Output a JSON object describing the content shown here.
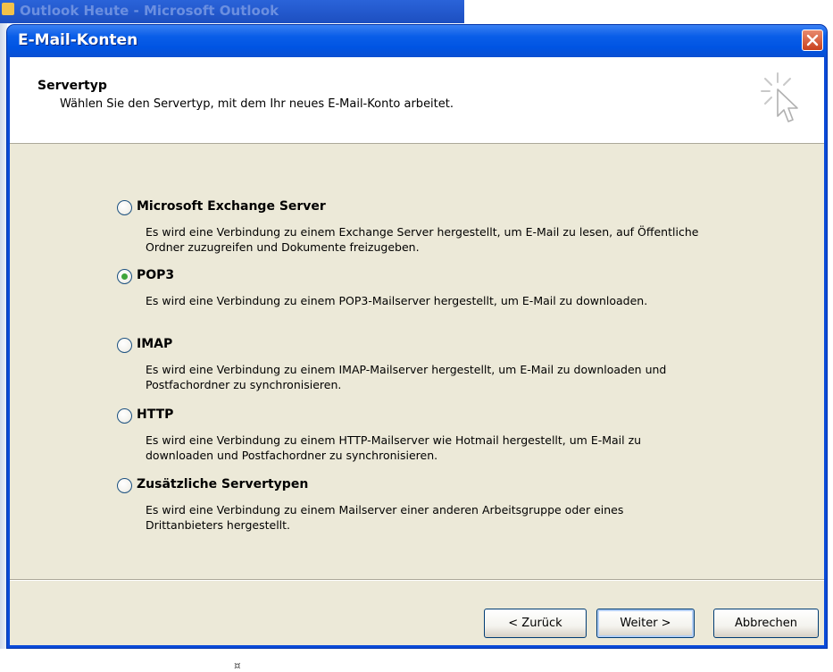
{
  "background_window": {
    "title": "Outlook Heute - Microsoft Outlook",
    "mark": "¤"
  },
  "dialog": {
    "title": "E-Mail-Konten",
    "close_icon": "close-icon"
  },
  "header": {
    "title": "Servertyp",
    "subtitle": "Wählen Sie den Servertyp, mit dem Ihr neues E-Mail-Konto arbeitet.",
    "icon": "wizard-cursor-icon"
  },
  "options": [
    {
      "label": "Microsoft Exchange Server",
      "description": "Es wird eine Verbindung zu einem Exchange Server hergestellt, um E-Mail zu lesen, auf Öffentliche Ordner zuzugreifen und Dokumente freizugeben.",
      "checked": false
    },
    {
      "label": "POP3",
      "description": "Es wird eine Verbindung zu einem POP3-Mailserver hergestellt, um E-Mail zu downloaden.",
      "checked": true
    },
    {
      "label": "IMAP",
      "description": "Es wird eine Verbindung zu einem IMAP-Mailserver hergestellt, um E-Mail zu downloaden und Postfachordner zu synchronisieren.",
      "checked": false
    },
    {
      "label": "HTTP",
      "description": "Es wird eine Verbindung zu einem HTTP-Mailserver wie Hotmail hergestellt, um E-Mail zu downloaden und Postfachordner zu synchronisieren.",
      "checked": false
    },
    {
      "label": "Zusätzliche Servertypen",
      "description": "Es wird eine Verbindung zu einem Mailserver einer anderen Arbeitsgruppe oder eines Drittanbieters hergestellt.",
      "checked": false
    }
  ],
  "buttons": {
    "back": "< Zurück",
    "next": "Weiter >",
    "cancel": "Abbrechen"
  },
  "colors": {
    "titlebar": "#0054e3",
    "dialog_face": "#ece9d8",
    "radio_checked": "#3fa53a"
  }
}
